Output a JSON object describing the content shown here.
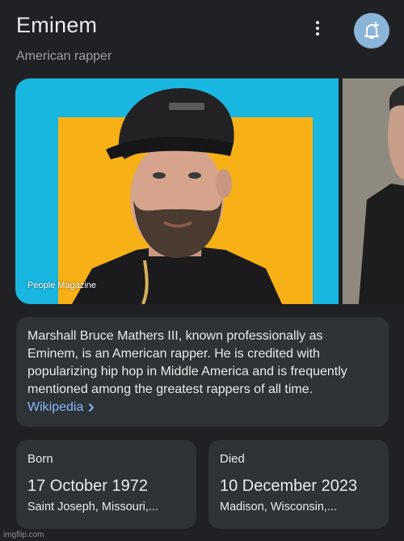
{
  "header": {
    "title": "Eminem",
    "subtitle": "American rapper",
    "more_icon": "more-vert-icon",
    "notify_icon": "add-alert-icon",
    "notify_color": "#8ab4d8"
  },
  "images": {
    "main_credit": "People Magazine",
    "main_bg": "#19b7e0",
    "main_accent": "#f7b116"
  },
  "description": {
    "text": "Marshall Bruce Mathers III, known professionally as Eminem, is an American rapper. He is credited with popularizing hip hop in Middle America and is frequently mentioned among the greatest rappers of all time.",
    "source_label": "Wikipedia",
    "link_color": "#8ab4f8"
  },
  "facts": {
    "born": {
      "label": "Born",
      "date": "17 October 1972",
      "place": "Saint Joseph, Missouri,..."
    },
    "died": {
      "label": "Died",
      "date": "10 December 2023",
      "place": "Madison, Wisconsin,..."
    }
  },
  "watermark": "imgflip.com"
}
